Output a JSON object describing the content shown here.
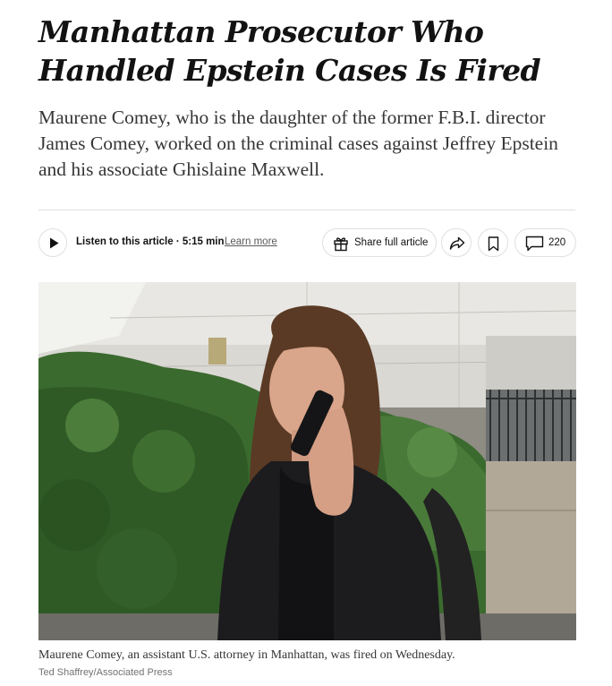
{
  "article": {
    "headline": "Manhattan Prosecutor Who Handled Epstein Cases Is Fired",
    "summary": "Maurene Comey, who is the daughter of the former F.B.I. director James Comey, worked on the criminal cases against Jeffrey Epstein and his associate Ghislaine Maxwell."
  },
  "toolbar": {
    "play_icon": "play-icon",
    "listen_label": "Listen to this article · 5:15 min",
    "learn_more": "Learn more",
    "share_full_label": "Share full article",
    "share_full_icon": "gift-icon",
    "share_icon": "share-arrow-icon",
    "save_icon": "bookmark-icon",
    "comments_icon": "comment-bubble-icon",
    "comments_count": "220"
  },
  "photo": {
    "caption": "Maurene Comey, an assistant U.S. attorney in Manhattan, was fired on Wednesday.",
    "credit": "Ted Shaffrey/Associated Press"
  }
}
